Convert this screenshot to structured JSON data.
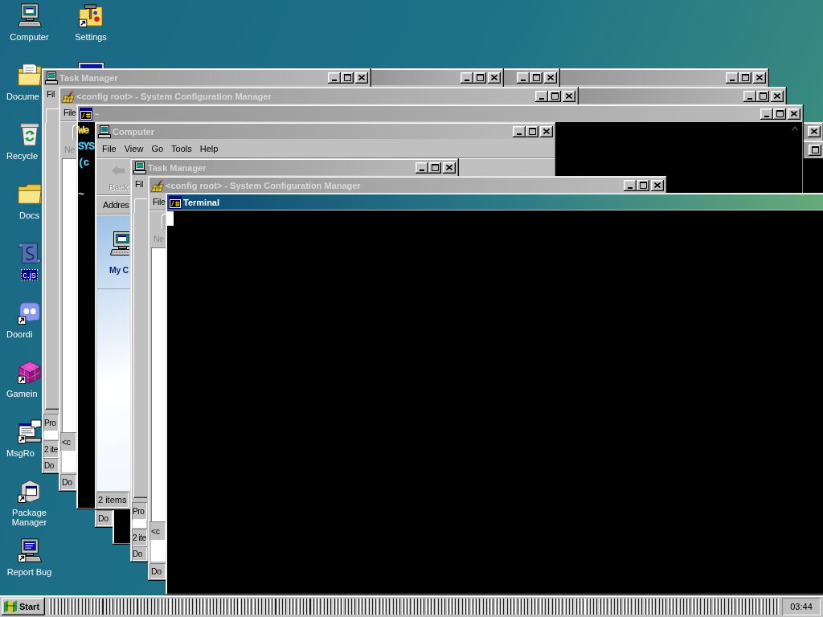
{
  "desktop_icons": [
    {
      "kind": "computer",
      "label": "Computer",
      "shortcut": false,
      "selected": false
    },
    {
      "kind": "documents_folder",
      "label": "Docume",
      "shortcut": false,
      "selected": false
    },
    {
      "kind": "recycle_bin",
      "label": "Recycle",
      "shortcut": false,
      "selected": false
    },
    {
      "kind": "folder",
      "label": "Docs",
      "shortcut": false,
      "selected": false
    },
    {
      "kind": "script",
      "label": "c.js",
      "shortcut": false,
      "selected": true
    },
    {
      "kind": "blob_face",
      "label": "Doordi",
      "shortcut": true,
      "selected": false
    },
    {
      "kind": "cube",
      "label": "Gamein",
      "shortcut": true,
      "selected": false
    },
    {
      "kind": "message_window",
      "label": "MsgRo",
      "shortcut": true,
      "selected": false
    },
    {
      "kind": "package",
      "label": "Package Manager",
      "shortcut": true,
      "selected": false
    },
    {
      "kind": "computer_bug",
      "label": "Report Bug",
      "shortcut": true,
      "selected": false
    },
    {
      "kind": "tools_folder",
      "label": "Settings",
      "shortcut": true,
      "selected": false
    },
    {
      "kind": "monitor",
      "selected": false
    }
  ],
  "windows": [
    {
      "kind": "plain",
      "active": false
    },
    {
      "kind": "plain",
      "active": false
    },
    {
      "kind": "plain",
      "active": false
    },
    {
      "kind": "task_manager",
      "title": "Task Manager",
      "active": false,
      "menu": [
        "Fil"
      ],
      "status": [
        "Pro",
        "2 ite",
        "Do"
      ]
    },
    {
      "kind": "plain",
      "active": false
    },
    {
      "kind": "config",
      "title": "<config root> - System Configuration Manager",
      "active": false,
      "menu": [
        "File"
      ],
      "label": {
        "text": "Ne",
        "disabled": true
      },
      "status": [
        "<c",
        "Do"
      ]
    },
    {
      "kind": "plain",
      "active": false,
      "status": [
        "Do"
      ]
    },
    {
      "kind": "terminal",
      "active": false
    },
    {
      "kind": "terminal",
      "title": "~",
      "active": false,
      "scroll_arrow": true,
      "lines": [
        {
          "kind": "welcome",
          "text": "We"
        },
        {
          "kind": "info",
          "text": "SYS"
        },
        {
          "kind": "info",
          "text": "(c"
        },
        {
          "kind": "prompt",
          "text": "~"
        }
      ]
    },
    {
      "kind": "explorer",
      "title": "Computer",
      "active": false,
      "menu": [
        "File",
        "View",
        "Go",
        "Tools",
        "Help"
      ],
      "toolbar": [
        {
          "kind": "back",
          "label": "Back",
          "disabled": true
        }
      ],
      "address_label": "Addres",
      "panel_heading": "My C",
      "status": [
        "2 items"
      ]
    },
    {
      "kind": "task_manager",
      "title": "Task Manager",
      "active": false,
      "menu": [
        "Fil"
      ],
      "status": [
        "Pro",
        "2 ite",
        "Do"
      ]
    },
    {
      "kind": "config",
      "title": "<config root> - System Configuration Manager",
      "active": false,
      "menu": [
        "File"
      ],
      "label": {
        "text": "Ne",
        "disabled": true
      },
      "status": [
        "<c",
        "Do"
      ]
    },
    {
      "kind": "terminal",
      "title": "Terminal",
      "active": true,
      "cursor": true
    }
  ],
  "taskbar": {
    "start_label": "Start",
    "clock": "03:44"
  }
}
